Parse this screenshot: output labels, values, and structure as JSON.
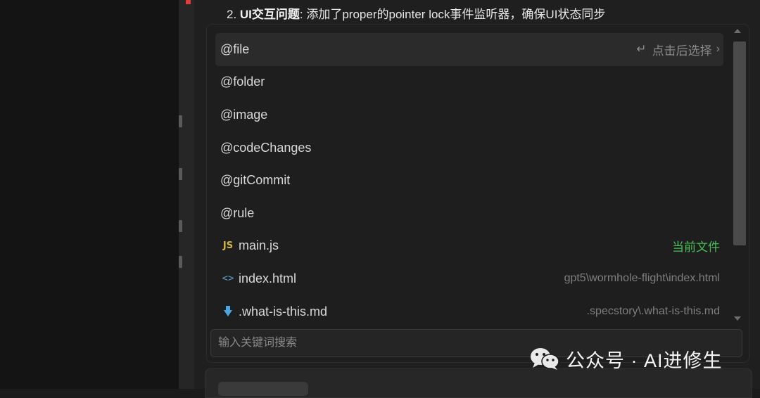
{
  "chat": {
    "message_prefix": "2. ",
    "message_bold": "UI交互问题",
    "message_rest": ": 添加了proper的pointer lock事件监听器，确保UI状态同步"
  },
  "popup": {
    "items": [
      {
        "label": "@file",
        "right_text": "点击后选择",
        "enter_glyph": "↵",
        "chevron_glyph": "›"
      },
      {
        "label": "@folder"
      },
      {
        "label": "@image"
      },
      {
        "label": "@codeChanges"
      },
      {
        "label": "@gitCommit"
      },
      {
        "label": "@rule"
      },
      {
        "label": "main.js",
        "icon_text": "JS",
        "right_text": "当前文件"
      },
      {
        "label": "index.html",
        "icon_text": "<>",
        "right_text": "gpt5\\wormhole-flight\\index.html"
      },
      {
        "label": ".what-is-this.md",
        "right_text": ".specstory\\.what-is-this.md"
      }
    ],
    "search_placeholder": "输入关键词搜索"
  },
  "watermark": {
    "text": "公众号 · AI进修生"
  },
  "colors": {
    "accent_green": "#4bbf56",
    "js_yellow": "#d6b640",
    "md_blue": "#4aa6e0",
    "panel_bg": "#1e1e1e"
  }
}
